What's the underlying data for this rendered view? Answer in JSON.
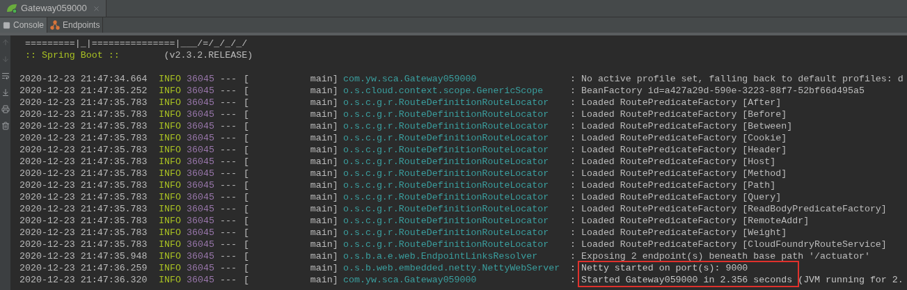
{
  "run_tab": {
    "title": "Gateway059000"
  },
  "tool_tabs": [
    {
      "label": "Console",
      "selected": true
    },
    {
      "label": "Endpoints",
      "selected": false
    }
  ],
  "banner": [
    {
      "kind": "art",
      "text": " =========|_|===============|___/=/_/_/_/"
    },
    {
      "kind": "version",
      "label": " :: Spring Boot ::",
      "version": "        (v2.3.2.RELEASE)"
    }
  ],
  "log_rows": [
    {
      "time": "2020-12-23 21:47:34.664",
      "level": "INFO",
      "pid": "36045",
      "sep": "---",
      "thread": "[           main]",
      "logger": "com.yw.sca.Gateway059000",
      "message": ": No active profile set, falling back to default profiles: d",
      "highlighted": false
    },
    {
      "time": "2020-12-23 21:47:35.252",
      "level": "INFO",
      "pid": "36045",
      "sep": "---",
      "thread": "[           main]",
      "logger": "o.s.cloud.context.scope.GenericScope",
      "message": ": BeanFactory id=a427a29d-590e-3223-88f7-52bf66d495a5",
      "highlighted": false
    },
    {
      "time": "2020-12-23 21:47:35.783",
      "level": "INFO",
      "pid": "36045",
      "sep": "---",
      "thread": "[           main]",
      "logger": "o.s.c.g.r.RouteDefinitionRouteLocator",
      "message": ": Loaded RoutePredicateFactory [After]",
      "highlighted": false
    },
    {
      "time": "2020-12-23 21:47:35.783",
      "level": "INFO",
      "pid": "36045",
      "sep": "---",
      "thread": "[           main]",
      "logger": "o.s.c.g.r.RouteDefinitionRouteLocator",
      "message": ": Loaded RoutePredicateFactory [Before]",
      "highlighted": false
    },
    {
      "time": "2020-12-23 21:47:35.783",
      "level": "INFO",
      "pid": "36045",
      "sep": "---",
      "thread": "[           main]",
      "logger": "o.s.c.g.r.RouteDefinitionRouteLocator",
      "message": ": Loaded RoutePredicateFactory [Between]",
      "highlighted": false
    },
    {
      "time": "2020-12-23 21:47:35.783",
      "level": "INFO",
      "pid": "36045",
      "sep": "---",
      "thread": "[           main]",
      "logger": "o.s.c.g.r.RouteDefinitionRouteLocator",
      "message": ": Loaded RoutePredicateFactory [Cookie]",
      "highlighted": false
    },
    {
      "time": "2020-12-23 21:47:35.783",
      "level": "INFO",
      "pid": "36045",
      "sep": "---",
      "thread": "[           main]",
      "logger": "o.s.c.g.r.RouteDefinitionRouteLocator",
      "message": ": Loaded RoutePredicateFactory [Header]",
      "highlighted": false
    },
    {
      "time": "2020-12-23 21:47:35.783",
      "level": "INFO",
      "pid": "36045",
      "sep": "---",
      "thread": "[           main]",
      "logger": "o.s.c.g.r.RouteDefinitionRouteLocator",
      "message": ": Loaded RoutePredicateFactory [Host]",
      "highlighted": false
    },
    {
      "time": "2020-12-23 21:47:35.783",
      "level": "INFO",
      "pid": "36045",
      "sep": "---",
      "thread": "[           main]",
      "logger": "o.s.c.g.r.RouteDefinitionRouteLocator",
      "message": ": Loaded RoutePredicateFactory [Method]",
      "highlighted": false
    },
    {
      "time": "2020-12-23 21:47:35.783",
      "level": "INFO",
      "pid": "36045",
      "sep": "---",
      "thread": "[           main]",
      "logger": "o.s.c.g.r.RouteDefinitionRouteLocator",
      "message": ": Loaded RoutePredicateFactory [Path]",
      "highlighted": false
    },
    {
      "time": "2020-12-23 21:47:35.783",
      "level": "INFO",
      "pid": "36045",
      "sep": "---",
      "thread": "[           main]",
      "logger": "o.s.c.g.r.RouteDefinitionRouteLocator",
      "message": ": Loaded RoutePredicateFactory [Query]",
      "highlighted": false
    },
    {
      "time": "2020-12-23 21:47:35.783",
      "level": "INFO",
      "pid": "36045",
      "sep": "---",
      "thread": "[           main]",
      "logger": "o.s.c.g.r.RouteDefinitionRouteLocator",
      "message": ": Loaded RoutePredicateFactory [ReadBodyPredicateFactory]",
      "highlighted": false
    },
    {
      "time": "2020-12-23 21:47:35.783",
      "level": "INFO",
      "pid": "36045",
      "sep": "---",
      "thread": "[           main]",
      "logger": "o.s.c.g.r.RouteDefinitionRouteLocator",
      "message": ": Loaded RoutePredicateFactory [RemoteAddr]",
      "highlighted": false
    },
    {
      "time": "2020-12-23 21:47:35.783",
      "level": "INFO",
      "pid": "36045",
      "sep": "---",
      "thread": "[           main]",
      "logger": "o.s.c.g.r.RouteDefinitionRouteLocator",
      "message": ": Loaded RoutePredicateFactory [Weight]",
      "highlighted": false
    },
    {
      "time": "2020-12-23 21:47:35.783",
      "level": "INFO",
      "pid": "36045",
      "sep": "---",
      "thread": "[           main]",
      "logger": "o.s.c.g.r.RouteDefinitionRouteLocator",
      "message": ": Loaded RoutePredicateFactory [CloudFoundryRouteService]",
      "highlighted": false
    },
    {
      "time": "2020-12-23 21:47:35.948",
      "level": "INFO",
      "pid": "36045",
      "sep": "---",
      "thread": "[           main]",
      "logger": "o.s.b.a.e.web.EndpointLinksResolver",
      "message": ": Exposing 2 endpoint(s) beneath base path '/actuator'",
      "highlighted": false
    },
    {
      "time": "2020-12-23 21:47:36.259",
      "level": "INFO",
      "pid": "36045",
      "sep": "---",
      "thread": "[           main]",
      "logger": "o.s.b.web.embedded.netty.NettyWebServer",
      "message": ": Netty started on port(s): 9000",
      "highlighted": true
    },
    {
      "time": "2020-12-23 21:47:36.320",
      "level": "INFO",
      "pid": "36045",
      "sep": "---",
      "thread": "[           main]",
      "logger": "com.yw.sca.Gateway059000",
      "message": ": Started Gateway059000 in 2.356 seconds (JVM running for 2.",
      "highlighted": true
    }
  ]
}
